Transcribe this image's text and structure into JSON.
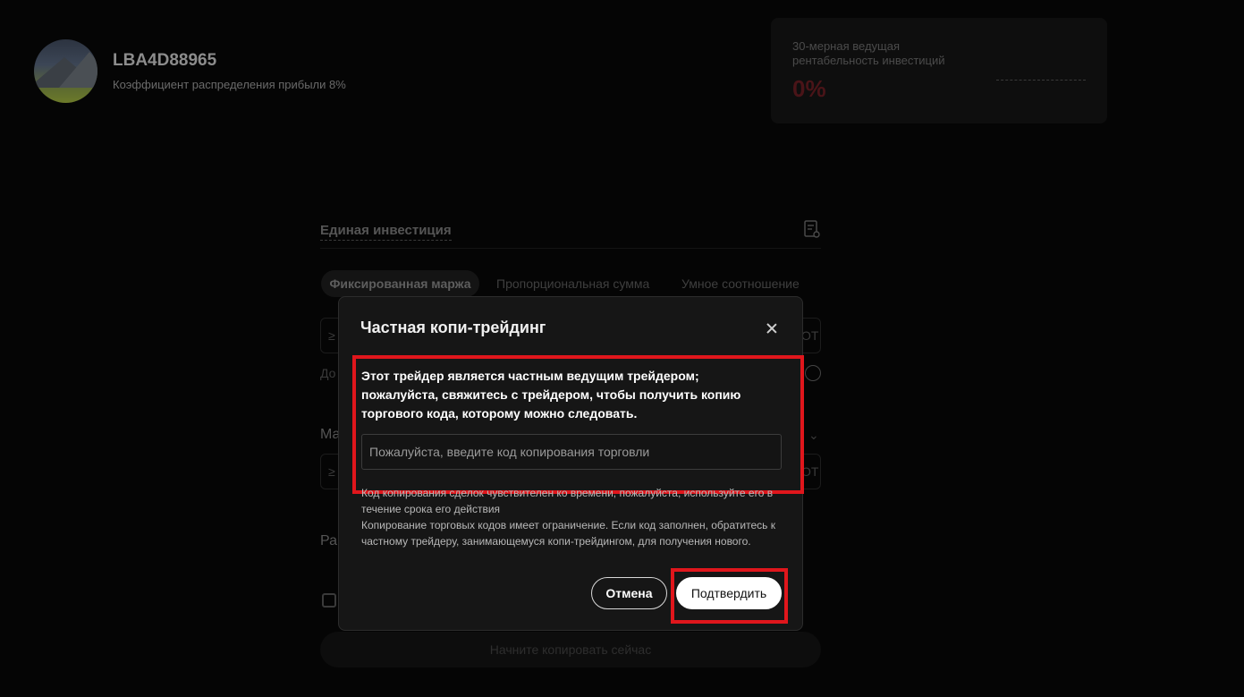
{
  "trader": {
    "name": "LBA4D88965",
    "profit_share": "Коэффициент распределения прибыли 8%"
  },
  "roi": {
    "label": "30-мерная ведущая рентабельность инвестиций",
    "value": "0%"
  },
  "investment": {
    "section_title": "Единая инвестиция",
    "tabs": [
      "Фиксированная маржа",
      "Пропорциональная сумма",
      "Умное соотношение"
    ],
    "partial_labels": {
      "input1_prefix": "≥",
      "input1_suffix": "ОТ",
      "hint_prefix": "До",
      "section2_prefix": "Ма",
      "input2_prefix": "≥",
      "input2_suffix": "ОТ",
      "section3_prefix": "Ра"
    },
    "start_copy_button": "Начните копировать сейчас"
  },
  "modal": {
    "title": "Частная копи-трейдинг",
    "notice": "Этот трейдер является частным ведущим трейдером; пожалуйста, свяжитесь с трейдером, чтобы получить копию торгового кода, которому можно следовать.",
    "code_placeholder": "Пожалуйста, введите код копирования торговли",
    "code_value": "",
    "hint_validity": "Код копирования сделок чувствителен ко времени, пожалуйста, используйте его в течение срока его действия",
    "hint_limit": "Копирование торговых кодов имеет ограничение. Если код заполнен, обратитесь к частному трейдеру, занимающемуся копи-трейдингом, для получения нового.",
    "cancel_label": "Отмена",
    "confirm_label": "Подтвердить"
  },
  "colors": {
    "highlight": "#e0161c",
    "roi_value": "#4a1418",
    "modal_bg": "#161616"
  }
}
